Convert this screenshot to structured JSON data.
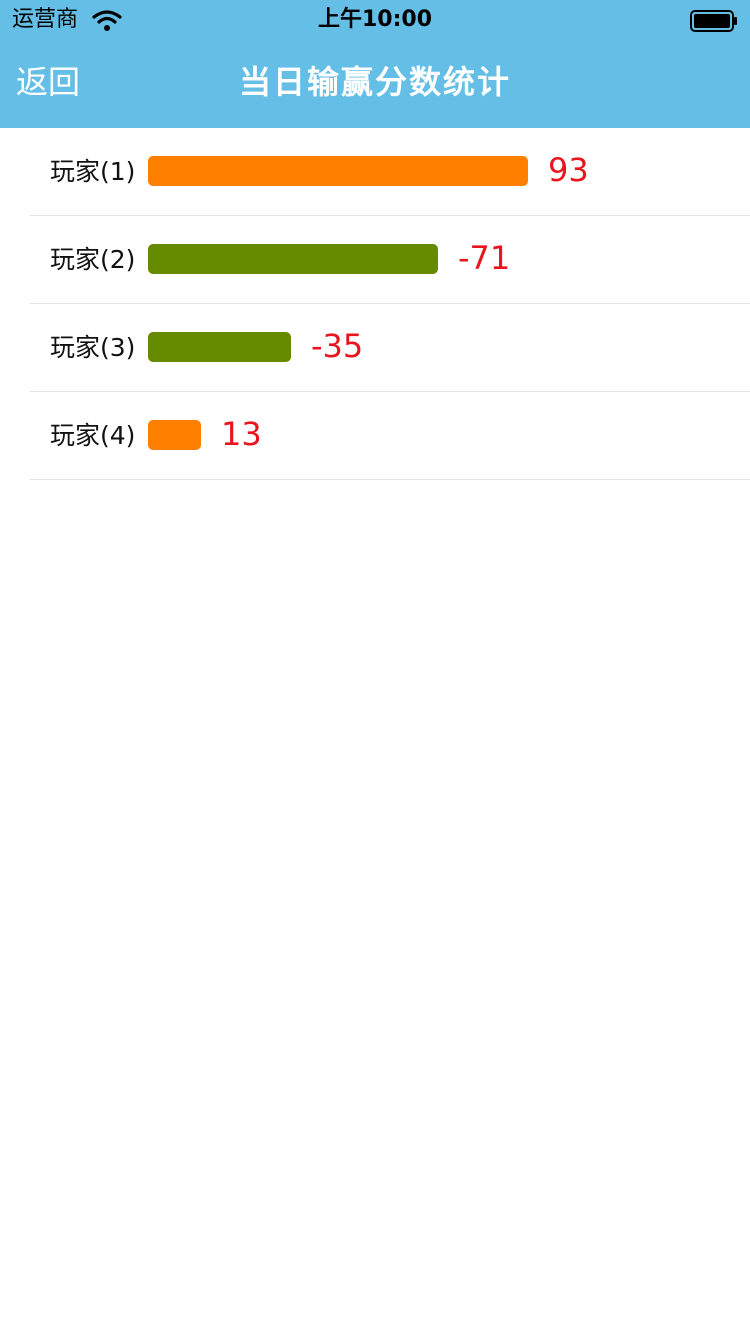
{
  "status_bar": {
    "carrier": "运营商",
    "time": "上午10:00"
  },
  "nav": {
    "back_label": "返回",
    "title": "当日输赢分数统计"
  },
  "colors": {
    "header_bg": "#64bee6",
    "positive_bar": "#ff7f00",
    "negative_bar": "#678b00",
    "score_text": "#e8141e"
  },
  "chart_data": {
    "type": "bar",
    "orientation": "horizontal",
    "categories": [
      "玩家(1)",
      "玩家(2)",
      "玩家(3)",
      "玩家(4)"
    ],
    "values": [
      93,
      -71,
      -35,
      13
    ],
    "value_labels": [
      "93",
      "-71",
      "-35",
      "13"
    ],
    "title": "当日输赢分数统计",
    "bar_length_encodes": "absolute value",
    "xlim": [
      0,
      93
    ],
    "legend": "none",
    "grid": false
  }
}
